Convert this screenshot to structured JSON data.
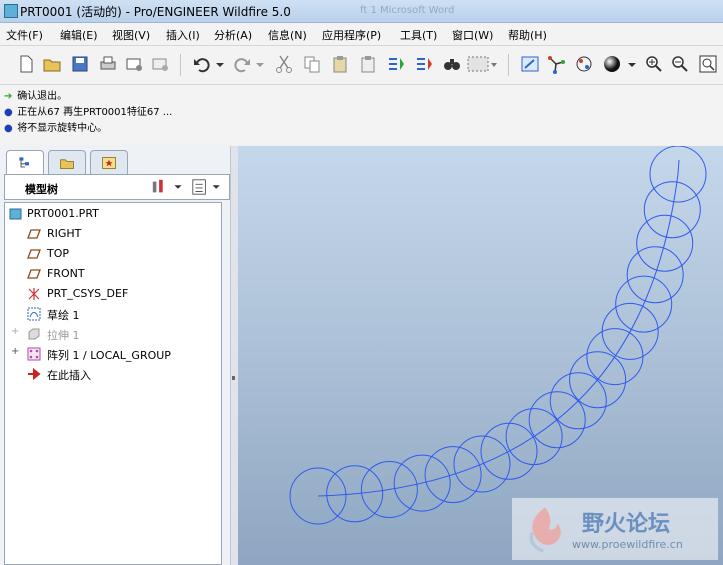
{
  "window": {
    "title": "PRT0001 (活动的) - Pro/ENGINEER Wildfire 5.0",
    "ghost_text": "ft 1 Microsoft Word"
  },
  "menu": [
    "文件(F)",
    "编辑(E)",
    "视图(V)",
    "插入(I)",
    "分析(A)",
    "信息(N)",
    "应用程序(P)",
    "工具(T)",
    "窗口(W)",
    "帮助(H)"
  ],
  "messages": [
    "确认退出。",
    "正在从67 再生PRT0001特征67 ...",
    "将不显示旋转中心。"
  ],
  "model_tree": {
    "header": "模型树",
    "items": [
      {
        "label": "PRT0001.PRT"
      },
      {
        "label": "RIGHT"
      },
      {
        "label": "TOP"
      },
      {
        "label": "FRONT"
      },
      {
        "label": "PRT_CSYS_DEF"
      },
      {
        "label": "草绘 1"
      },
      {
        "label": "拉伸 1"
      },
      {
        "label": "阵列 1 / LOCAL_GROUP"
      },
      {
        "label": "在此插入"
      }
    ]
  },
  "watermark": {
    "title": "野火论坛",
    "url": "www.proewildfire.cn"
  },
  "colors": {
    "viewport_top": "#c5d7ea",
    "viewport_bottom": "#8ea6c1",
    "curve": "#2f5bf0",
    "accent": "#1a3fb8"
  }
}
